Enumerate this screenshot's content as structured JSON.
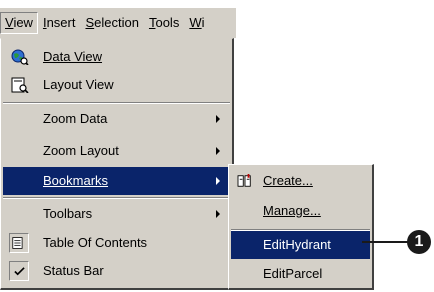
{
  "menubar": {
    "items": [
      {
        "label": "View",
        "accel": "V"
      },
      {
        "label": "Insert",
        "accel": "I"
      },
      {
        "label": "Selection",
        "accel": "S"
      },
      {
        "label": "Tools",
        "accel": "T"
      },
      {
        "label": "Wi",
        "accel": "W"
      }
    ]
  },
  "view_menu": {
    "data_view": "Data View",
    "layout_view": "Layout View",
    "zoom_data": "Zoom Data",
    "zoom_layout": "Zoom Layout",
    "bookmarks": "Bookmarks",
    "toolbars": "Toolbars",
    "table_of_contents": "Table Of Contents",
    "status_bar": "Status Bar"
  },
  "bookmarks_menu": {
    "create": "Create...",
    "manage": "Manage...",
    "bookmark_1": "EditHydrant",
    "bookmark_2": "EditParcel"
  },
  "callout": {
    "number": "1"
  },
  "colors": {
    "menu_bg": "#d4d0c8",
    "highlight": "#0a246a"
  }
}
